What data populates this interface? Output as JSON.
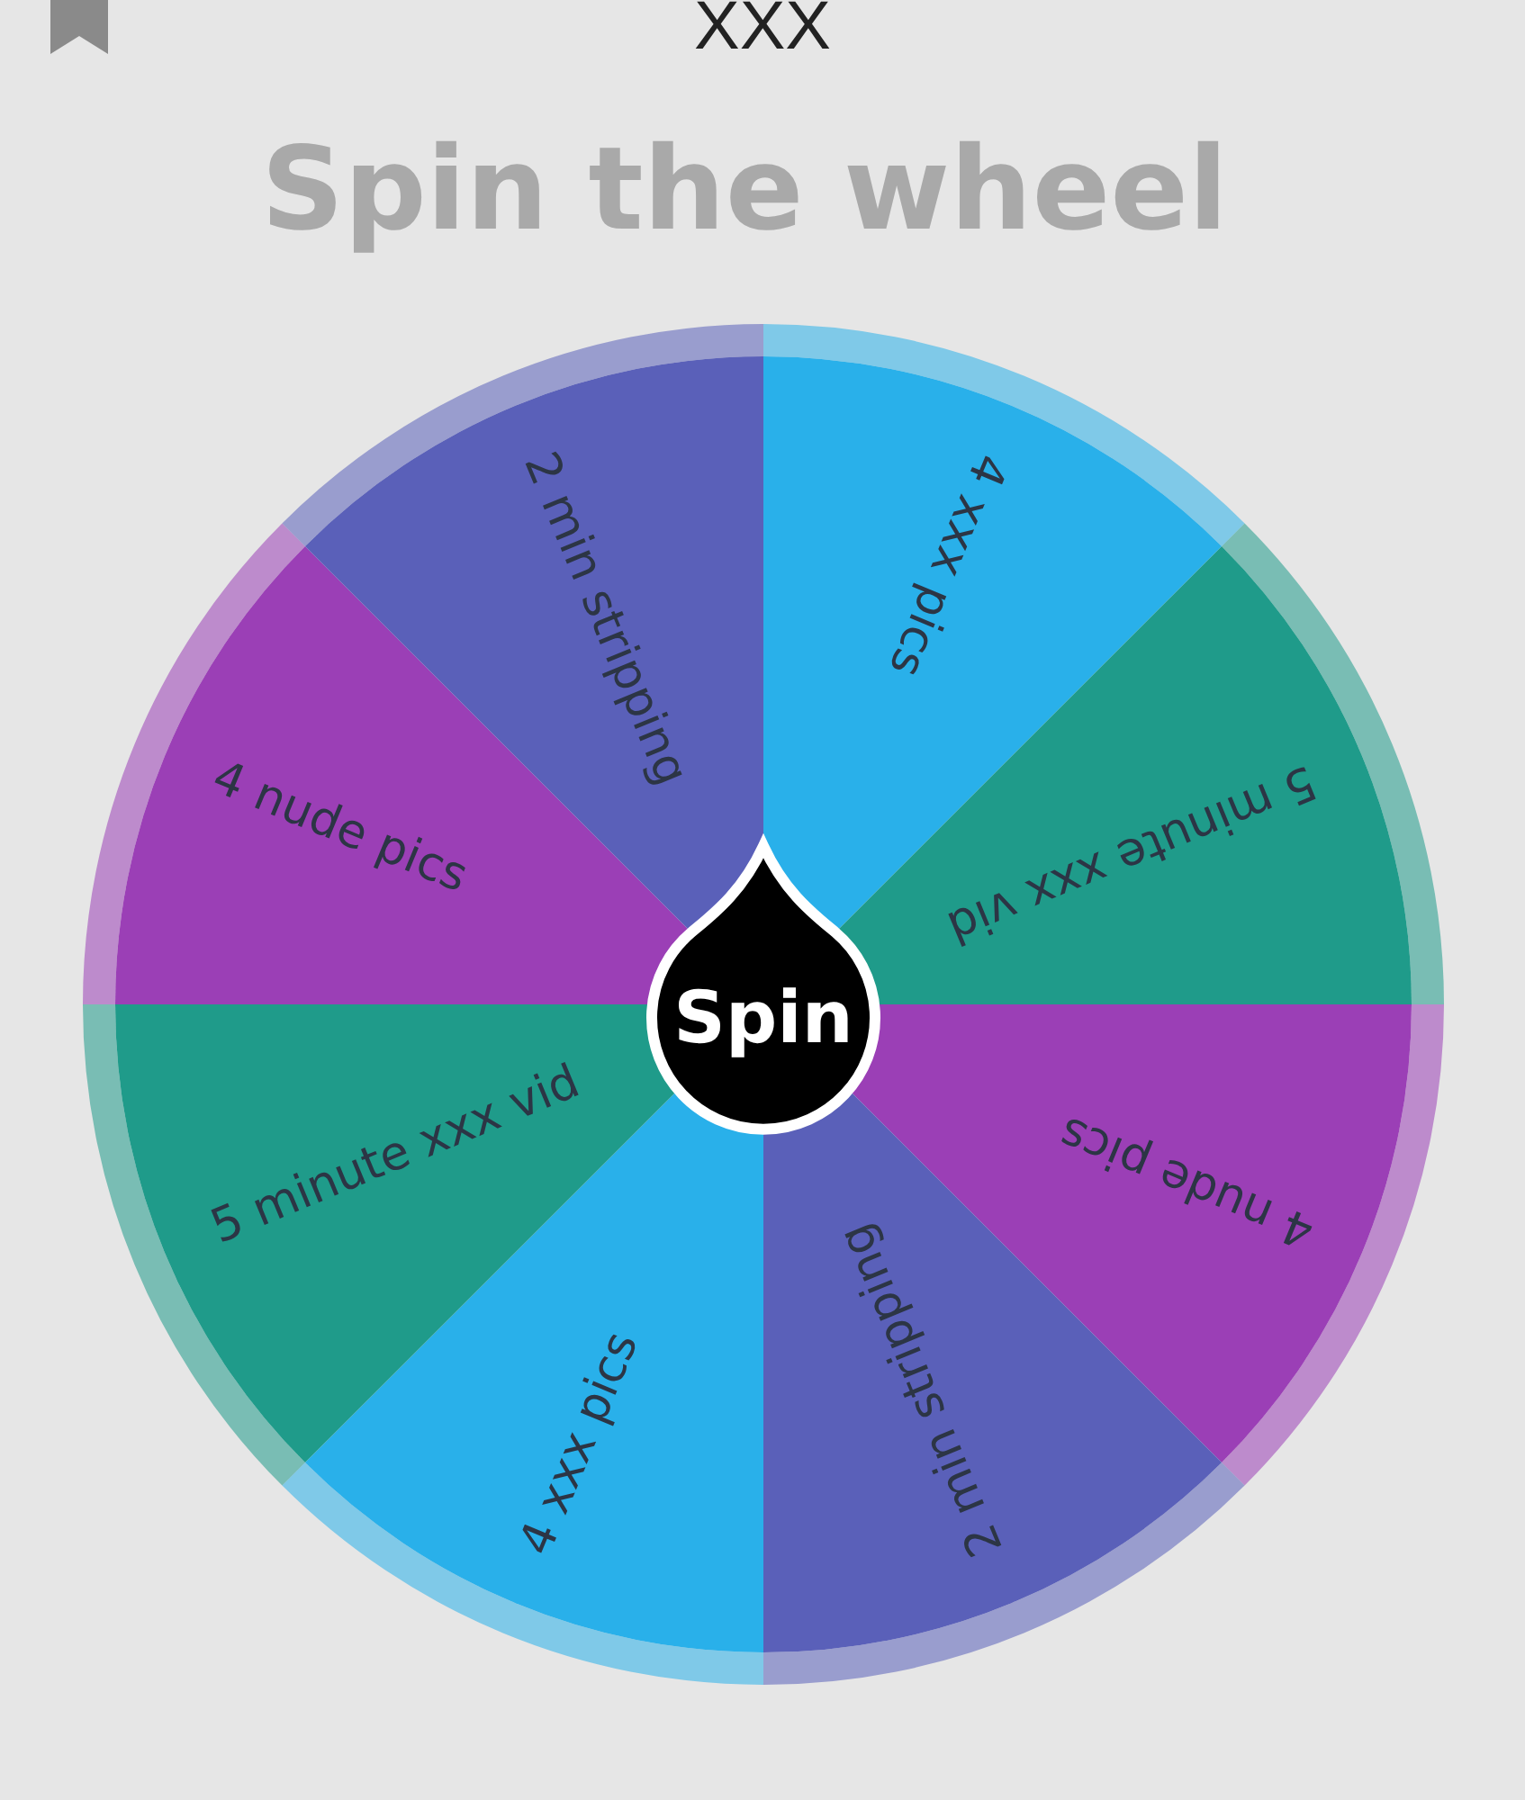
{
  "page_title": "XXX",
  "heading": "Spin the wheel",
  "wheel": {
    "segments": [
      {
        "label": "4 xxx pics",
        "color": "#29b0ea"
      },
      {
        "label": "5 minute xxx vid",
        "color": "#1f9b8a"
      },
      {
        "label": "4 nude pics",
        "color": "#9b3fb6"
      },
      {
        "label": "2 min stripping",
        "color": "#5a60b9"
      },
      {
        "label": "4 xxx pics",
        "color": "#29b0ea"
      },
      {
        "label": "5 minute xxx vid",
        "color": "#1f9b8a"
      },
      {
        "label": "4 nude pics",
        "color": "#9b3fb6"
      },
      {
        "label": "2 min stripping",
        "color": "#5a60b9"
      }
    ],
    "spin_button": "Spin"
  }
}
